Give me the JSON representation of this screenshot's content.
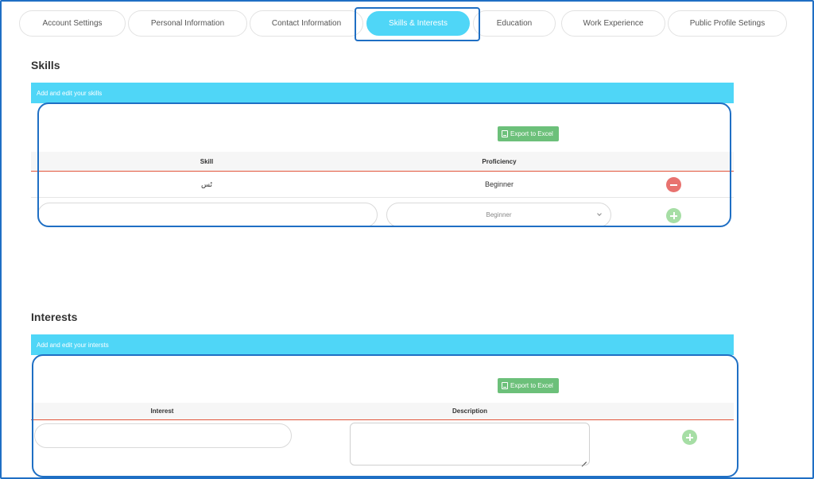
{
  "tabs": [
    {
      "label": "Account Settings"
    },
    {
      "label": "Personal Information"
    },
    {
      "label": "Contact Information"
    },
    {
      "label": "Skills & Interests",
      "active": true
    },
    {
      "label": "Education"
    },
    {
      "label": "Work Experience"
    },
    {
      "label": "Public Profile Setings"
    }
  ],
  "skills": {
    "heading": "Skills",
    "bar_text": "Add and edit your skills",
    "export_label": "Export to Excel",
    "columns": {
      "skill": "Skill",
      "proficiency": "Proficiency"
    },
    "rows": [
      {
        "skill": "ٹس",
        "proficiency": "Beginner"
      }
    ],
    "new_row": {
      "skill_value": "",
      "proficiency_value": "Beginner"
    }
  },
  "interests": {
    "heading": "Interests",
    "bar_text": "Add and edit your intersts",
    "export_label": "Export to Excel",
    "columns": {
      "interest": "Interest",
      "description": "Description"
    },
    "new_row": {
      "interest_value": "",
      "description_value": ""
    }
  },
  "colors": {
    "accent": "#4fd6f7",
    "outline": "#1f6fc4",
    "export": "#6cc07a",
    "remove": "#e8726f",
    "add": "#a6dea5",
    "header_rule": "#e2553b"
  }
}
